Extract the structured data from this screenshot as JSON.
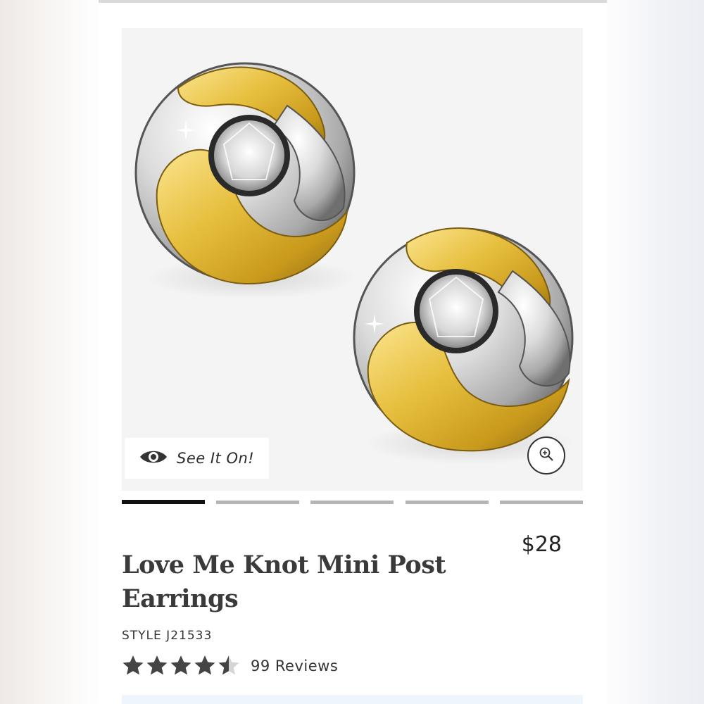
{
  "product": {
    "title": "Love Me Knot Mini Post Earrings",
    "price": "$28",
    "style": "STYLE J21533",
    "rating": 4.5,
    "rating_max": 5,
    "reviews_label": "99 Reviews"
  },
  "gallery": {
    "see_it_on_label": "See It On!",
    "image_count": 5,
    "active_index": 0,
    "icons": [
      "eye-icon",
      "zoom-in-icon"
    ]
  },
  "colors": {
    "gold": "#e1b83b",
    "silver": "#d8d8d8",
    "star": "#444444",
    "active_indicator": "#111111"
  }
}
